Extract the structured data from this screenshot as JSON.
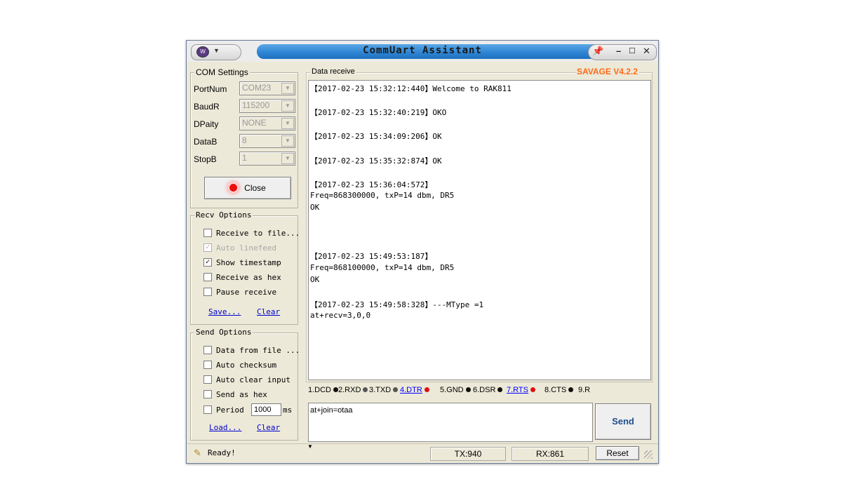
{
  "window": {
    "title": "CommUart Assistant",
    "version_label": "SAVAGE V4.2.2"
  },
  "com_settings": {
    "legend": "COM Settings",
    "fields": [
      {
        "label": "PortNum",
        "value": "COM23"
      },
      {
        "label": "BaudR",
        "value": "115200"
      },
      {
        "label": "DPaity",
        "value": "NONE"
      },
      {
        "label": "DataB",
        "value": "8"
      },
      {
        "label": "StopB",
        "value": "1"
      }
    ],
    "close_button": "Close"
  },
  "recv_options": {
    "legend": "Recv Options",
    "items": [
      {
        "label": "Receive to file...",
        "checked": false,
        "disabled": false
      },
      {
        "label": "Auto linefeed",
        "checked": true,
        "disabled": true
      },
      {
        "label": "Show timestamp",
        "checked": true,
        "disabled": false
      },
      {
        "label": "Receive as hex",
        "checked": false,
        "disabled": false
      },
      {
        "label": "Pause receive",
        "checked": false,
        "disabled": false
      }
    ],
    "save_link": "Save...",
    "clear_link": "Clear"
  },
  "send_options": {
    "legend": "Send Options",
    "items": [
      {
        "label": "Data from file ...",
        "checked": false
      },
      {
        "label": "Auto checksum",
        "checked": false
      },
      {
        "label": "Auto clear input",
        "checked": false
      },
      {
        "label": "Send as hex",
        "checked": false
      }
    ],
    "period_label": "Period",
    "period_value": "1000",
    "period_unit": "ms",
    "load_link": "Load...",
    "clear_link": "Clear"
  },
  "data_receive": {
    "legend": "Data receive",
    "lines": [
      "【2017-02-23 15:32:12:440】Welcome to RAK811",
      "",
      "【2017-02-23 15:32:40:219】OKO",
      "",
      "【2017-02-23 15:34:09:206】OK",
      "",
      "【2017-02-23 15:35:32:874】OK",
      "",
      "【2017-02-23 15:36:04:572】",
      "Freq=868300000, txP=14 dbm, DR5",
      "OK",
      "",
      "",
      "",
      "【2017-02-23 15:49:53:187】",
      "Freq=868100000, txP=14 dbm, DR5",
      "OK",
      "",
      "【2017-02-23 15:49:58:328】---MType =1",
      "at+recv=3,0,0"
    ]
  },
  "signals": [
    {
      "label": "1.DCD",
      "color": "#111111",
      "link": false
    },
    {
      "label": "2.RXD",
      "color": "#555555",
      "link": false
    },
    {
      "label": "3.TXD",
      "color": "#555555",
      "link": false
    },
    {
      "label": "4.DTR",
      "color": "#e01010",
      "link": true
    },
    {
      "label": "5.GND",
      "color": "#111111",
      "link": false
    },
    {
      "label": "6.DSR",
      "color": "#111111",
      "link": false
    },
    {
      "label": "7.RTS",
      "color": "#e01010",
      "link": true
    },
    {
      "label": "8.CTS",
      "color": "#111111",
      "link": false
    },
    {
      "label": "9.R",
      "color": "#111111",
      "link": false
    }
  ],
  "send": {
    "input_value": "at+join=otaa",
    "button": "Send"
  },
  "status": {
    "ready": "Ready!",
    "tx": "TX:940",
    "rx": "RX:861",
    "reset": "Reset"
  }
}
